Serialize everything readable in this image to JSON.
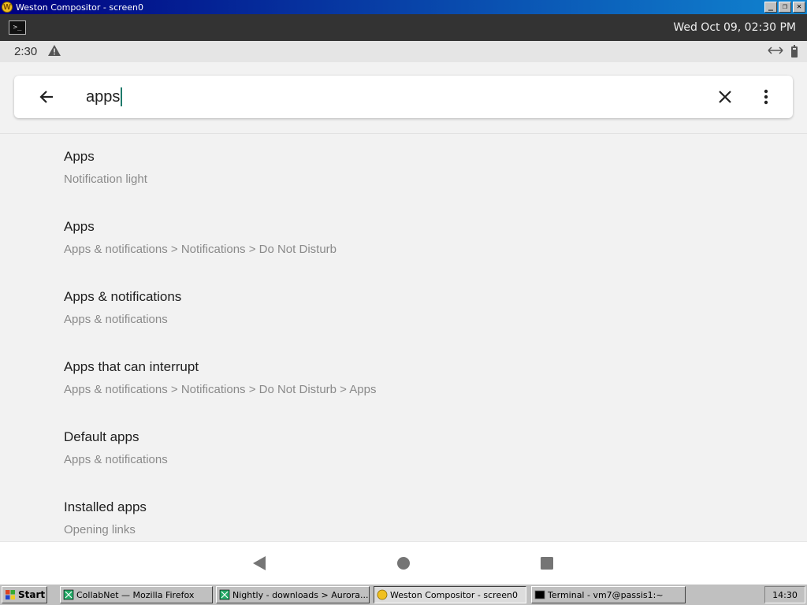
{
  "window": {
    "title": "Weston Compositor - screen0",
    "buttons": [
      "_",
      "❐",
      "✕"
    ]
  },
  "weston_panel": {
    "clock": "Wed Oct 09, 02:30 PM"
  },
  "status_bar": {
    "time": "2:30"
  },
  "search": {
    "query": "apps"
  },
  "results": [
    {
      "title": "Apps",
      "summary": "Notification light"
    },
    {
      "title": "Apps",
      "summary": "Apps & notifications > Notifications > Do Not Disturb"
    },
    {
      "title": "Apps & notifications",
      "summary": "Apps & notifications"
    },
    {
      "title": "Apps that can interrupt",
      "summary": "Apps & notifications > Notifications > Do Not Disturb > Apps"
    },
    {
      "title": "Default apps",
      "summary": "Apps & notifications"
    },
    {
      "title": "Installed apps",
      "summary": "Opening links"
    }
  ],
  "taskbar": {
    "start_label": "Start",
    "tasks": [
      {
        "label": "CollabNet — Mozilla Firefox"
      },
      {
        "label": "Nightly - downloads > Aurora..."
      },
      {
        "label": "Weston Compositor - screen0"
      },
      {
        "label": "Terminal - vm7@passis1:~"
      }
    ],
    "clock": "14:30"
  }
}
